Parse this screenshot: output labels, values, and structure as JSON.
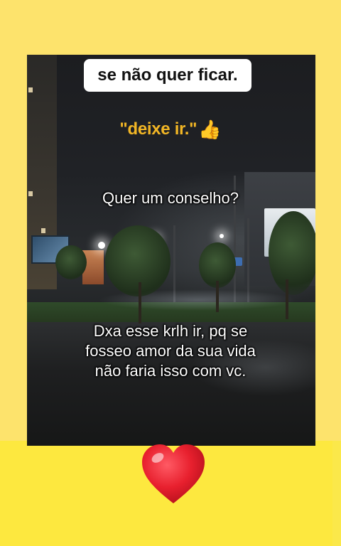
{
  "header": {
    "pill_text": "se não quer ficar."
  },
  "quote": {
    "text": "\"deixe ir.\"",
    "icon": "thumbs-up-emoji"
  },
  "captions": {
    "question": "Quer um conselho?",
    "answer_lines": [
      "Dxa esse krlh ir, pq se",
      "fosseo amor da sua vida",
      "não faria isso com vc."
    ]
  },
  "footer": {
    "icon": "red-heart-emoji"
  },
  "colors": {
    "background": "#fde26a",
    "bottom_band": "#fde83f",
    "quote_accent": "#f2b625",
    "heart": "#e8202e"
  }
}
